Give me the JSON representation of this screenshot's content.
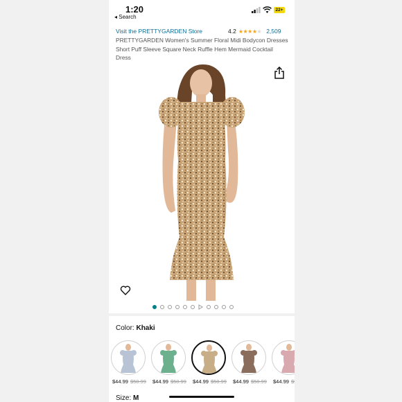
{
  "status_bar": {
    "time": "1:20",
    "back_label": "◂ Search",
    "battery": "22+"
  },
  "header": {
    "store_link": "Visit the PRETTYGARDEN Store",
    "rating_value": "4.2",
    "rating_stars": 4.2,
    "rating_count": "2,509",
    "title": "PRETTYGARDEN Women's Summer Floral Midi Bodycon Dresses Short Puff Sleeve Square Neck Ruffle Hem Mermaid Cocktail Dress"
  },
  "gallery": {
    "total_images": 11,
    "active_index": 0,
    "video_index": 6,
    "icons": {
      "share": "share-icon",
      "favorite": "heart-icon"
    }
  },
  "color": {
    "label": "Color:",
    "selected": "Khaki",
    "options": [
      {
        "price": "$44.99",
        "was": "$50.99",
        "tone": "#b9c3d6",
        "selected": false
      },
      {
        "price": "$44.99",
        "was": "$50.99",
        "tone": "#6db08e",
        "selected": false
      },
      {
        "price": "$44.99",
        "was": "$50.99",
        "tone": "#c8ae86",
        "selected": true
      },
      {
        "price": "$44.99",
        "was": "$50.99",
        "tone": "#8a6d5c",
        "selected": false
      },
      {
        "price": "$44.99",
        "was": "$5",
        "tone": "#d9a9b0",
        "selected": false
      }
    ]
  },
  "size": {
    "label": "Size:",
    "selected": "M"
  },
  "colors": {
    "link": "#0f6e96",
    "star": "#f4a41c",
    "active_dot": "#00818a"
  }
}
